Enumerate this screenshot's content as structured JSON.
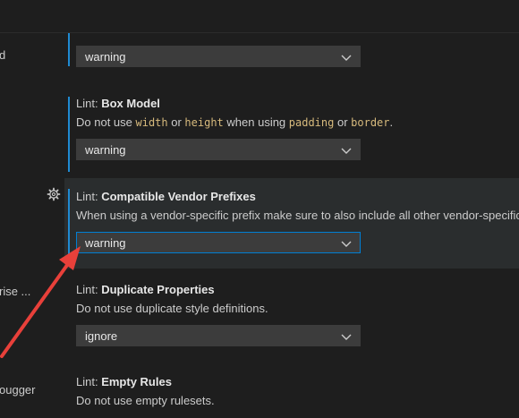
{
  "left_pane": {
    "items": [
      {
        "text": "d"
      },
      {
        "text": "rise ..."
      },
      {
        "text": "ougger"
      }
    ]
  },
  "settings": [
    {
      "category": "",
      "title": "",
      "description": "",
      "value": "warning"
    },
    {
      "category": "Lint: ",
      "title": "Box Model",
      "desc_parts": [
        "Do not use ",
        "width",
        " or ",
        "height",
        " when using ",
        "padding",
        " or ",
        "border",
        "."
      ],
      "value": "warning"
    },
    {
      "category": "Lint: ",
      "title": "Compatible Vendor Prefixes",
      "description": "When using a vendor-specific prefix make sure to also include all other vendor-specific",
      "value": "warning"
    },
    {
      "category": "Lint: ",
      "title": "Duplicate Properties",
      "description": "Do not use duplicate style definitions.",
      "value": "ignore"
    },
    {
      "category": "Lint: ",
      "title": "Empty Rules",
      "description": "Do not use empty rulesets."
    }
  ],
  "icons": {
    "gear": "gear-icon",
    "chevron": "chevron-down-icon",
    "annotation": "red-arrow-annotation"
  },
  "colors": {
    "background": "#1e1e1e",
    "focused_row": "#2a2d2e",
    "accent": "#1f8ad2",
    "select_bg": "#3c3c3c",
    "focus_border": "#007fd4",
    "code": "#d7ba7d",
    "annotation": "#e8403a"
  }
}
